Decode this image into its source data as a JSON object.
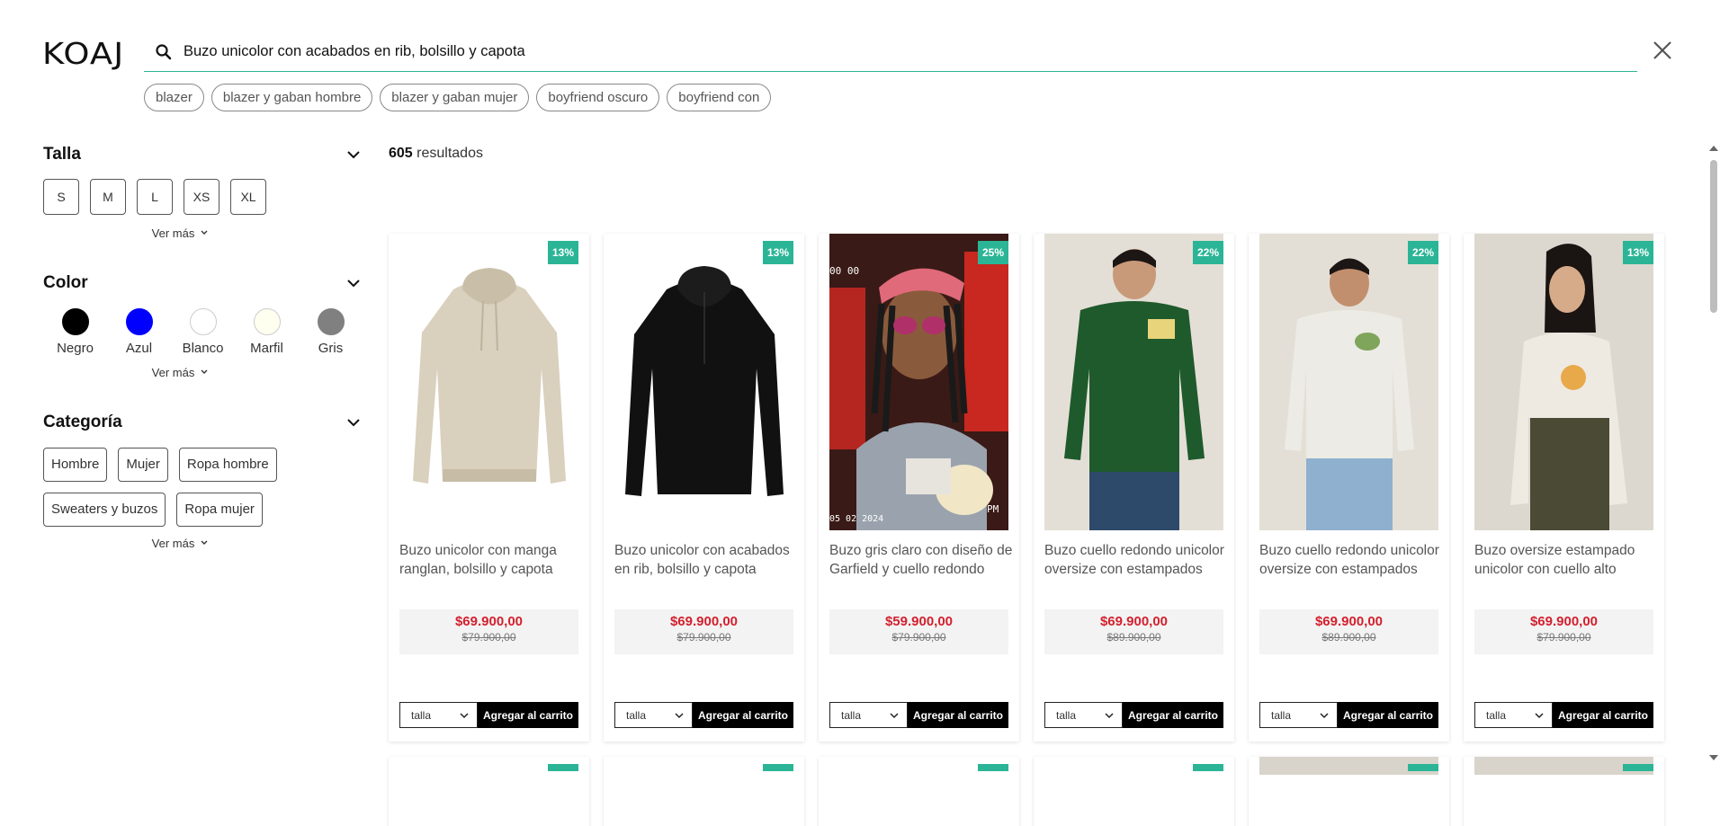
{
  "header": {
    "logo": "KOAJ",
    "search_value": "Buzo unicolor con acabados en rib, bolsillo y capota",
    "suggestions": [
      "blazer",
      "blazer y gaban hombre",
      "blazer y gaban mujer",
      "boyfriend oscuro",
      "boyfriend con"
    ]
  },
  "filters": {
    "size": {
      "title": "Talla",
      "options": [
        "S",
        "M",
        "L",
        "XS",
        "XL"
      ],
      "more": "Ver más"
    },
    "color": {
      "title": "Color",
      "options": [
        {
          "label": "Negro",
          "hex": "#000000"
        },
        {
          "label": "Azul",
          "hex": "#0000ff"
        },
        {
          "label": "Blanco",
          "hex": "#ffffff"
        },
        {
          "label": "Marfil",
          "hex": "#fffff0"
        },
        {
          "label": "Gris",
          "hex": "#808080"
        }
      ],
      "more": "Ver más"
    },
    "category": {
      "title": "Categoría",
      "options": [
        "Hombre",
        "Mujer",
        "Ropa hombre",
        "Sweaters y buzos",
        "Ropa mujer"
      ],
      "more": "Ver más"
    }
  },
  "results": {
    "count": "605",
    "count_label": "resultados"
  },
  "products": [
    {
      "discount": "13%",
      "name": "Buzo unicolor con manga ranglan, bolsillo y capota",
      "price": "$69.900,00",
      "old_price": "$79.900,00",
      "size_placeholder": "talla",
      "cart_label": "Agregar al carrito"
    },
    {
      "discount": "13%",
      "name": "Buzo unicolor con acabados en rib, bolsillo y capota",
      "price": "$69.900,00",
      "old_price": "$79.900,00",
      "size_placeholder": "talla",
      "cart_label": "Agregar al carrito"
    },
    {
      "discount": "25%",
      "name": "Buzo gris claro con diseño de Garfield y cuello redondo",
      "price": "$59.900,00",
      "old_price": "$79.900,00",
      "size_placeholder": "talla",
      "cart_label": "Agregar al carrito"
    },
    {
      "discount": "22%",
      "name": "Buzo cuello redondo unicolor oversize con estampados",
      "price": "$69.900,00",
      "old_price": "$89.900,00",
      "size_placeholder": "talla",
      "cart_label": "Agregar al carrito"
    },
    {
      "discount": "22%",
      "name": "Buzo cuello redondo unicolor oversize con estampados",
      "price": "$69.900,00",
      "old_price": "$89.900,00",
      "size_placeholder": "talla",
      "cart_label": "Agregar al carrito"
    },
    {
      "discount": "13%",
      "name": "Buzo oversize estampado unicolor con cuello alto",
      "price": "$69.900,00",
      "old_price": "$79.900,00",
      "size_placeholder": "talla",
      "cart_label": "Agregar al carrito"
    }
  ],
  "product_image_text": {
    "timer": "00 00",
    "date": "05 02 2024",
    "pm": "PM"
  },
  "colors": {
    "accent": "#2bb596",
    "price": "#d3202e",
    "button": "#000000"
  }
}
